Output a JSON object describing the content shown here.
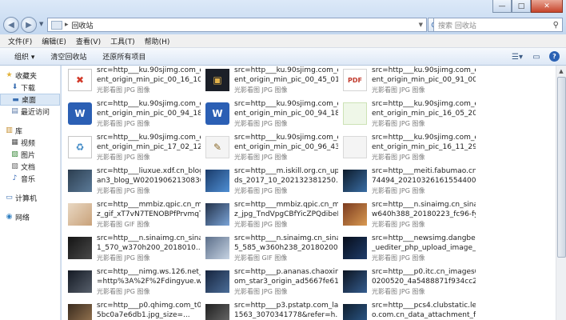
{
  "window": {
    "minimize": "—",
    "maximize": "□",
    "close": "✕"
  },
  "nav": {
    "back_icon": "back-arrow",
    "forward_icon": "forward-arrow",
    "address_path": "回收站",
    "address_arrow": "▸",
    "search_placeholder": "搜索 回收站"
  },
  "menu": [
    "文件(F)",
    "编辑(E)",
    "查看(V)",
    "工具(T)",
    "帮助(H)"
  ],
  "toolbar": {
    "organize": "组织 ▾",
    "empty_bin": "清空回收站",
    "restore_all": "还原所有项目"
  },
  "sidebar": {
    "favorites": "收藏夹",
    "downloads": "下载",
    "desktop": "桌面",
    "recent": "最近访问",
    "library": "库",
    "videos": "视频",
    "pictures": "图片",
    "documents": "文档",
    "music": "音乐",
    "computer": "计算机",
    "network": "网络"
  },
  "files": [
    {
      "line1": "src=http___ku.90sjimg.com_elem",
      "line2": "ent_origin_min_pic_00_16_10_9...",
      "type": "光影看图 JPG 图像",
      "icon": "doc-x-icon",
      "glyph": "✖"
    },
    {
      "line1": "src=http___ku.90sjimg.com_elem",
      "line2": "ent_origin_min_pic_00_45_01_6...",
      "type": "光影看图 JPG 图像",
      "icon": "dark-image-icon",
      "glyph": "▣"
    },
    {
      "line1": "src=http___ku.90sjimg.com_elem",
      "line2": "ent_origin_min_pic_00_91_00_5...",
      "type": "光影看图 JPG 图像",
      "icon": "pdf-icon",
      "glyph": "PDF"
    },
    {
      "line1": "src=http___ku.90sjimg.com_elem",
      "line2": "ent_origin_min_pic_00_94_18_9...",
      "type": "光影看图 JPG 图像",
      "icon": "word-icon",
      "glyph": "W"
    },
    {
      "line1": "src=http___ku.90sjimg.com_elem",
      "line2": "ent_origin_min_pic_00_94_18_9...",
      "type": "光影看图 JPG 图像",
      "icon": "word-icon",
      "glyph": "W"
    },
    {
      "line1": "src=http___ku.90sjimg.com_elem",
      "line2": "ent_origin_min_pic_16_05_20_1...",
      "type": "光影看图 JPG 图像",
      "icon": "green-image-icon",
      "glyph": ""
    },
    {
      "line1": "src=http___ku.90sjimg.com_elem",
      "line2": "ent_origin_min_pic_17_02_12_0...",
      "type": "光影看图 JPG 图像",
      "icon": "recycle-icon",
      "glyph": "♻"
    },
    {
      "line1": "src=http___ku.90sjimg.com_elem",
      "line2": "ent_origin_min_pic_00_96_43_7356f3016bd...",
      "type": "光影看图 JPG 图像",
      "icon": "clip-image-icon",
      "glyph": "✎"
    },
    {
      "line1": "src=http___ku.90sjimg.com_elem",
      "line2": "ent_origin_min_pic_16_11_29_88a8dc7e0d...",
      "type": "光影看图 JPG 图像",
      "icon": "light-image-icon",
      "glyph": ""
    },
    {
      "line1": "src=http___liuxue.xdf.cn_blog_yul",
      "line2": "an3_blog_W02019062130830...",
      "type": "光影看图 JPG 图像",
      "icon": "photo-icon",
      "glyph": ""
    },
    {
      "line1": "src=http___m.iskill.org.cn_uploa",
      "line2": "ds_2017_10_202132381250...",
      "type": "光影看图 JPG 图像",
      "icon": "photo-icon",
      "glyph": ""
    },
    {
      "line1": "src=http___meiti.fabumao.cn_11",
      "line2": "74494_20210326161554400...",
      "type": "光影看图 JPG 图像",
      "icon": "photo-icon",
      "glyph": ""
    },
    {
      "line1": "src=http___mmbiz.qpic.cn_mmbi",
      "line2": "z_gif_xT7vN7TENOBPfPrvmqT...",
      "type": "光影看图 GIF 图像",
      "icon": "photo-icon",
      "glyph": ""
    },
    {
      "line1": "src=http___mmbiz.qpic.cn_mmbi",
      "line2": "z_jpg_TndVpgCBfYicZPQdibeF...",
      "type": "光影看图 JPG 图像",
      "icon": "photo-icon",
      "glyph": ""
    },
    {
      "line1": "src=http___n.sinaimg.cn_sinacn_",
      "line2": "w640h388_20180223_fc96-fyrs...",
      "type": "光影看图 JPG 图像",
      "icon": "photo-icon",
      "glyph": ""
    },
    {
      "line1": "src=http___n.sinaimg.cn_sinacn1",
      "line2": "1_570_w370h200_2018010...",
      "type": "光影看图 JPG 图像",
      "icon": "photo-icon",
      "glyph": ""
    },
    {
      "line1": "src=http___n.sinaimg.cn_sinacn1",
      "line2": "5_585_w360h238_20180200...",
      "type": "光影看图 GIF 图像",
      "icon": "photo-icon",
      "glyph": ""
    },
    {
      "line1": "src=http___newsimg.dangbei.net",
      "line2": "_uediter_php_upload_image_2...",
      "type": "光影看图 JPG 图像",
      "icon": "photo-icon",
      "glyph": ""
    },
    {
      "line1": "src=http___nimg.ws.126.net_url",
      "line2": "=http%3A%2F%2Fdingyue.ws....",
      "type": "光影看图 JPG 图像",
      "icon": "photo-icon",
      "glyph": ""
    },
    {
      "line1": "src=http___p.ananas.chaoxing.c",
      "line2": "om_star3_origin_ad5667fe61a...",
      "type": "光影看图 JPG 图像",
      "icon": "photo-icon",
      "glyph": ""
    },
    {
      "line1": "src=http___p0.itc.cn_images03_2",
      "line2": "0200520_4a5488871f934cc2...",
      "type": "光影看图 JPG 图像",
      "icon": "photo-icon",
      "glyph": ""
    },
    {
      "line1": "src=http___p0.qhimg.com_t0101",
      "line2": "5bc0a7e6db1.jpg_size=...",
      "type": "光影看图 JPG 图像",
      "icon": "photo-icon",
      "glyph": ""
    },
    {
      "line1": "src=http___p3.pstatp.com_large_",
      "line2": "1563_3070341778&refer=h...",
      "type": "光影看图 JPG 图像",
      "icon": "photo-icon",
      "glyph": ""
    },
    {
      "line1": "src=http___pcs4.clubstatic.lenov",
      "line2": "o.com.cn_data_attachment_for...",
      "type": "光影看图 JPG 图像",
      "icon": "photo-icon",
      "glyph": ""
    }
  ]
}
